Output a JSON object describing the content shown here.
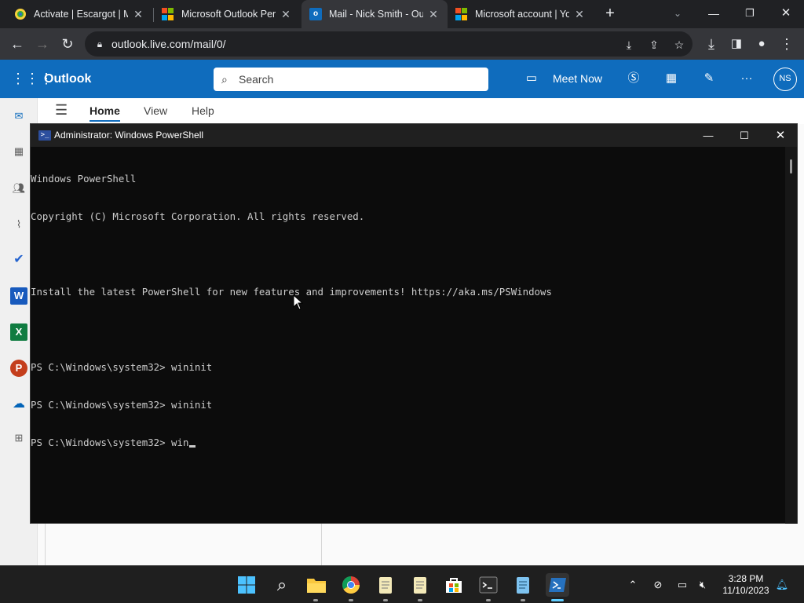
{
  "browser": {
    "tabs": [
      {
        "title": "Activate | Escargot | MS",
        "favicon": "escargot-icon"
      },
      {
        "title": "Microsoft Outlook Pers",
        "favicon": "microsoft-logo-icon"
      },
      {
        "title": "Mail - Nick Smith - Out",
        "favicon": "outlook-icon",
        "active": true
      },
      {
        "title": "Microsoft account | You",
        "favicon": "microsoft-logo-icon"
      }
    ],
    "url": "outlook.live.com/mail/0/"
  },
  "outlook": {
    "app_name": "Outlook",
    "search_placeholder": "Search",
    "meet_now": "Meet Now",
    "avatar_initials": "NS",
    "ribbon_tabs": [
      "Home",
      "View",
      "Help"
    ],
    "left_rail": [
      "mail-icon",
      "calendar-icon",
      "people-icon",
      "attachment-icon",
      "todo-icon",
      "word-icon",
      "excel-icon",
      "powerpoint-icon",
      "onedrive-icon",
      "more-apps-icon"
    ]
  },
  "powershell": {
    "title": "Administrator: Windows PowerShell",
    "lines": [
      "Windows PowerShell",
      "Copyright (C) Microsoft Corporation. All rights reserved.",
      "",
      "Install the latest PowerShell for new features and improvements! https://aka.ms/PSWindows",
      "",
      "PS C:\\Windows\\system32> wininit",
      "PS C:\\Windows\\system32> wininit"
    ],
    "current_prompt": "PS C:\\Windows\\system32> win"
  },
  "taskbar": {
    "apps": [
      "start-icon",
      "search-icon",
      "file-explorer-icon",
      "chrome-icon",
      "notepad-icon",
      "notepad-icon",
      "microsoft-store-icon",
      "terminal-icon",
      "notepad-icon",
      "powershell-icon"
    ],
    "time": "3:28 PM",
    "date": "11/10/2023"
  },
  "colors": {
    "outlook_blue": "#0f6cbd",
    "console_bg": "#0c0c0c",
    "console_text": "#cccccc"
  }
}
